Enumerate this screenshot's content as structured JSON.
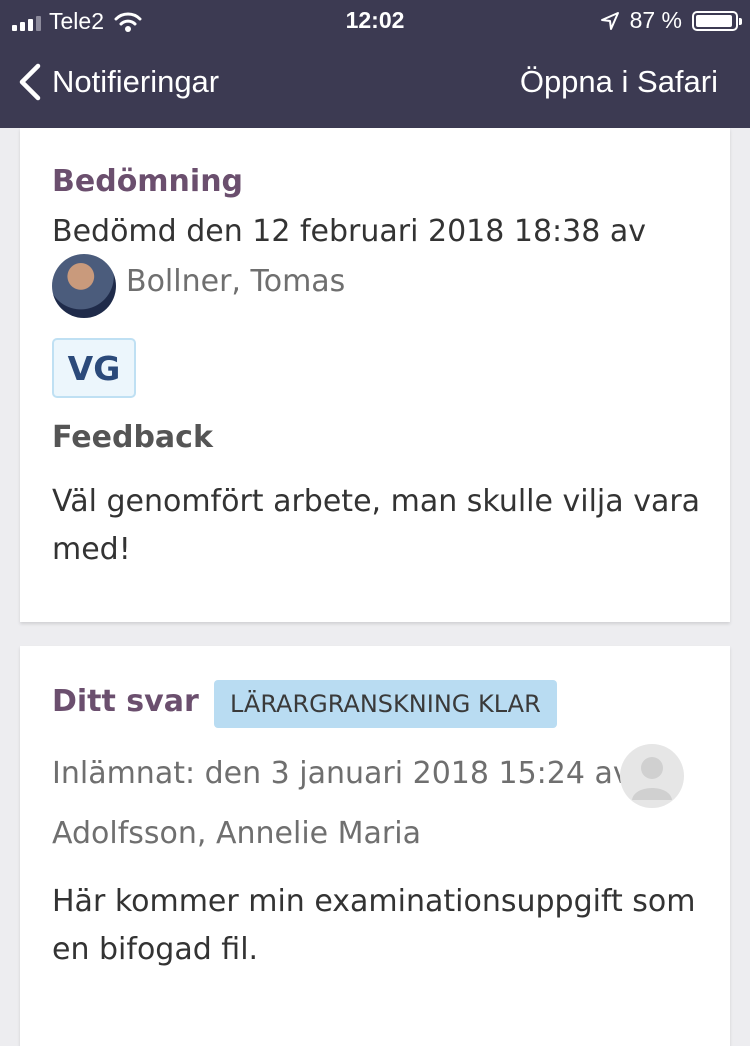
{
  "status_bar": {
    "carrier": "Tele2",
    "time": "12:02",
    "battery": "87 %",
    "battery_level": 0.87
  },
  "nav": {
    "back_label": "Notifieringar",
    "open_safari_label": "Öppna i Safari"
  },
  "assessment": {
    "title": "Bedömning",
    "graded_line": "Bedömd den 12 februari 2018 18:38 av",
    "grader_name": "Bollner, Tomas",
    "grade": "VG",
    "feedback_heading": "Feedback",
    "feedback_line1": "Väl genomfört arbete, man skulle vilja vara",
    "feedback_line2": "med!"
  },
  "answer": {
    "title": "Ditt svar",
    "status_badge": "LÄRARGRANSKNING KLAR",
    "submitted_line": "Inlämnat: den 3 januari 2018 15:24 av",
    "submitter_name": "Adolfsson, Annelie Maria",
    "body_line1": "Här kommer min examinationsuppgift som",
    "body_line2": "en bifogad fil."
  },
  "colors": {
    "nav_background": "#3c3a52",
    "title_color": "#6b4f6e",
    "badge_blue": "#b9dcf2"
  }
}
